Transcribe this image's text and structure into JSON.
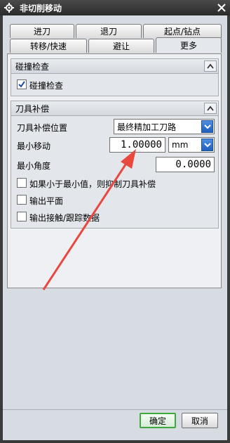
{
  "window": {
    "title": "非切削移动"
  },
  "tabs_row1": [
    {
      "label": "进刀"
    },
    {
      "label": "退刀"
    },
    {
      "label": "起点/钻点"
    }
  ],
  "tabs_row2": [
    {
      "label": "转移/快速"
    },
    {
      "label": "避让"
    },
    {
      "label": "更多"
    }
  ],
  "collision": {
    "header": "碰撞检查",
    "checkbox_label": "碰撞检查",
    "checked": true
  },
  "tool_comp": {
    "header": "刀具补偿",
    "position_label": "刀具补偿位置",
    "position_value": "最终精加工刀路",
    "min_move_label": "最小移动",
    "min_move_value": "1.00000",
    "min_move_unit": "mm",
    "min_angle_label": "最小角度",
    "min_angle_value": "0.0000",
    "option1_label": "如果小于最小值，则抑制刀具补偿",
    "option2_label": "输出平面",
    "option3_label": "输出接触/跟踪数据"
  },
  "footer": {
    "ok_label": "确定",
    "cancel_label": "取消"
  },
  "colors": {
    "arrow": "#e8493f",
    "dropdown": "#2a6fd0",
    "ok_border": "#3fa83f"
  }
}
